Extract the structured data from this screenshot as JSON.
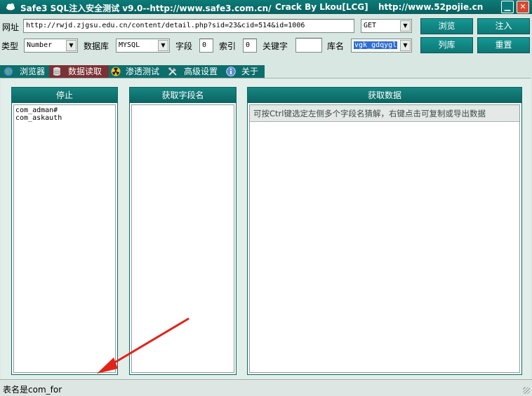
{
  "window": {
    "title_app": "Safe3 SQL注入安全测试 v9.0--http://www.safe3.com.cn/",
    "title_crack": "Crack  By  Lkou[LCG]",
    "title_site": "http://www.52pojie.cn",
    "minimize_glyph": "▁",
    "close_glyph": "✕"
  },
  "toolbar": {
    "url_label": "网址",
    "url_value": "http://rwjd.zjgsu.edu.cn/content/detail.php?sid=23&cid=514&id=1006",
    "method_value": "GET",
    "type_label": "类型",
    "type_value": "Number",
    "db_label": "数据库",
    "db_value": "MYSQL",
    "field_label": "字段",
    "field_value": "0",
    "index_label": "索引",
    "index_value": "0",
    "keyword_label": "关键字",
    "keyword_value": "",
    "dbname_label": "库名",
    "dbname_value": "vgk_gdqygl",
    "browse_label": "浏览",
    "inject_label": "注入",
    "list_db_label": "列库",
    "reset_label": "重置"
  },
  "tabs": [
    {
      "label": "浏览器",
      "icon": "globe-icon"
    },
    {
      "label": "数据读取",
      "icon": "database-icon"
    },
    {
      "label": "渗透测试",
      "icon": "radiation-icon"
    },
    {
      "label": "高级设置",
      "icon": "tools-icon"
    },
    {
      "label": "关于",
      "icon": "info-icon"
    }
  ],
  "columns": {
    "tables_header": "停止",
    "tables": [
      "com_adman#",
      "com_askauth"
    ],
    "fields_header": "获取字段名",
    "data_header": "获取数据",
    "data_hint": "可按Ctrl键选定左侧多个字段名猜解，右键点击可复制或导出数据"
  },
  "status": {
    "text": "表名是com_for"
  },
  "colors": {
    "title_bar": "#0c7b78",
    "active_tab": "#7b3135",
    "button": "#12908d",
    "annotation_arrow": "#e0241b"
  }
}
